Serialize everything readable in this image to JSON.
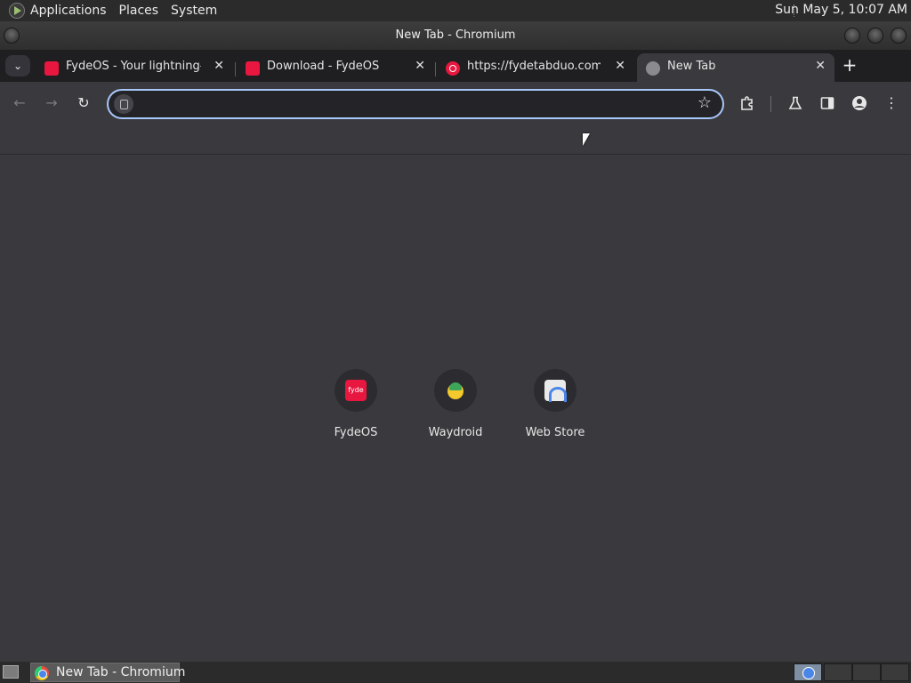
{
  "top_panel": {
    "menus": [
      "Applications",
      "Places",
      "System"
    ],
    "clock": "Sun May  5, 10:07 AM"
  },
  "window": {
    "title": "New Tab - Chromium"
  },
  "tabs": [
    {
      "label": "FydeOS - Your lightning-fa",
      "favicon": "fydeos-icon",
      "active": false
    },
    {
      "label": "Download - FydeOS",
      "favicon": "fydeos-icon",
      "active": false
    },
    {
      "label": "https://fydetabduo.com/",
      "favicon": "fydetabduo-icon",
      "active": false
    },
    {
      "label": "New Tab",
      "favicon": "globe-icon",
      "active": true
    }
  ],
  "toolbar": {
    "back": "←",
    "forward": "→",
    "reload": "↻",
    "omnibox_value": "",
    "star": "☆"
  },
  "shortcuts": [
    {
      "name": "FydeOS",
      "icon": "fydeos-icon"
    },
    {
      "name": "Waydroid",
      "icon": "waydroid-icon"
    },
    {
      "name": "Web Store",
      "icon": "webstore-icon"
    }
  ],
  "shortcut_icon_text": {
    "fyde": "fyde"
  },
  "taskbar": {
    "task_label": "New Tab - Chromium"
  },
  "colors": {
    "accent": "#a8c7fa",
    "fydeos_red": "#e8173f",
    "background": "#3a3a3e"
  }
}
